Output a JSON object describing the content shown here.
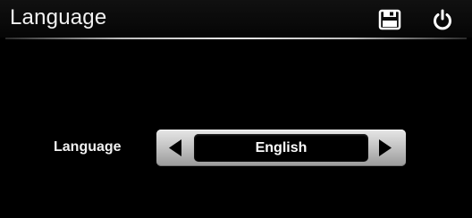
{
  "header": {
    "title": "Language",
    "save_icon": "save-icon",
    "power_icon": "power-icon"
  },
  "setting": {
    "label": "Language",
    "value": "English",
    "prev_icon": "arrow-left-icon",
    "next_icon": "arrow-right-icon"
  },
  "colors": {
    "background": "#000000",
    "text": "#ffffff",
    "selector_gradient_top": "#e6e6e6",
    "selector_gradient_bottom": "#9a9a9a"
  }
}
